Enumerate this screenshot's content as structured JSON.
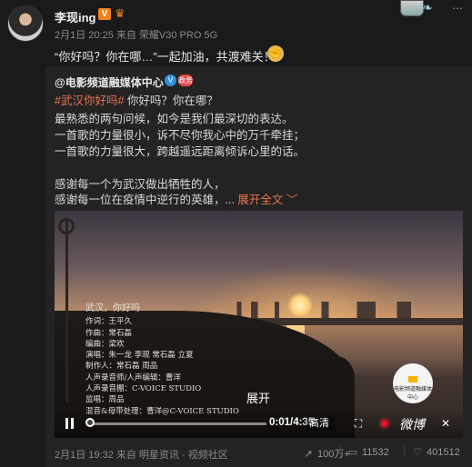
{
  "author": {
    "name": "李现ing",
    "vip_badge": "V",
    "meta": "2月1日 20:25 来自 荣耀V30 PRO 5G",
    "text": "“你好吗？你在哪…”一起加油，共渡难关！"
  },
  "repost": {
    "source": "@电影频道融媒体中心",
    "org_badge": "政务",
    "lines": [
      {
        "hashtag": "#武汉你好吗#",
        "text": " 你好吗？你在哪？"
      },
      {
        "text": "最熟悉的两句问候，如今是我们最深切的表达。"
      },
      {
        "text": "一首歌的力量很小，诉不尽你我心中的万千牵挂；"
      },
      {
        "text": "一首歌的力量很大，跨越遥远距离倾诉心里的话。"
      },
      {
        "text": ""
      },
      {
        "text": "感谢每一个为武汉做出牺牲的人，"
      },
      {
        "text": "感谢每一位在疫情中逆行的英雄，... ",
        "expand": "展开全文 ﹀"
      }
    ],
    "video": {
      "credits_title": "武汉，你好吗",
      "credits": [
        "作词：王平久",
        "作曲：常石磊",
        "编曲：梁欢",
        "演唱：朱一龙 李现 常石磊 立夏",
        "制作人：常石磊 周品",
        "人声录音师/人声编辑：曹洋",
        "人声录音棚：C-VOICE STUDIO",
        "监唱：周品",
        "混音&母带处理：曹洋@C-VOICE STUDIO"
      ],
      "unfold_label": "展开",
      "channel_logo_text": "电影频道融媒体中心",
      "time": "0:01/4:35",
      "progress_fraction": 0.004,
      "quality": "高清",
      "weibo_brand": "微博"
    },
    "footer": {
      "meta": "2月1日 19:32 来自 明星资讯 · 视频社区",
      "reposts": "100万+",
      "comments": "11532",
      "likes": "401512"
    }
  },
  "icons": {
    "crown": "♛",
    "wing": "❧",
    "more": "⋯",
    "muscle": "💪",
    "verified": "V",
    "fullscreen": "⛶",
    "weibo": "◉",
    "mute": "✕",
    "repost": "↗",
    "comment": "▭",
    "like": "♡"
  }
}
